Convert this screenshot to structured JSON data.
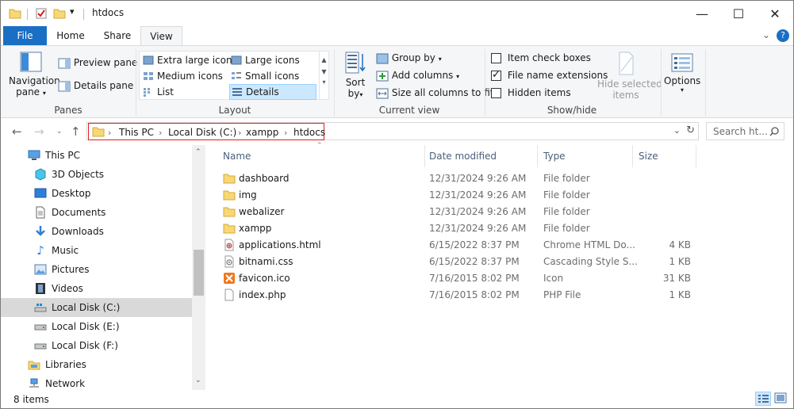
{
  "window": {
    "title": "htdocs",
    "controls": {
      "minimize": "—",
      "maximize": "☐",
      "close": "✕"
    }
  },
  "quick_access": {
    "icons": [
      "folder-icon",
      "properties-check-icon",
      "new-folder-icon",
      "customize-dropdown-icon"
    ],
    "dropdown": "▾"
  },
  "ribbon_tabs": {
    "file": "File",
    "home": "Home",
    "share": "Share",
    "view": "View",
    "expand": "⌄",
    "help": "?"
  },
  "ribbon": {
    "panes": {
      "label": "Panes",
      "navigation_pane": "Navigation",
      "navigation_pane_2": "pane",
      "preview_pane": "Preview pane",
      "details_pane": "Details pane"
    },
    "layout": {
      "label": "Layout",
      "items": {
        "extra_large": "Extra large icons",
        "large": "Large icons",
        "medium": "Medium icons",
        "small": "Small icons",
        "list": "List",
        "details": "Details"
      },
      "selected": "Details"
    },
    "current_view": {
      "label": "Current view",
      "sort_by": "Sort",
      "sort_by_2": "by",
      "group_by": "Group by",
      "add_columns": "Add columns",
      "size_all": "Size all columns to fit"
    },
    "show_hide": {
      "label": "Show/hide",
      "item_check_boxes": {
        "label": "Item check boxes",
        "checked": false
      },
      "file_name_extensions": {
        "label": "File name extensions",
        "checked": true
      },
      "hidden_items": {
        "label": "Hidden items",
        "checked": false
      },
      "hide_selected": "Hide selected",
      "hide_selected_2": "items"
    },
    "options": {
      "label": "Options"
    }
  },
  "address": {
    "crumbs": [
      "This PC",
      "Local Disk (C:)",
      "xampp",
      "htdocs"
    ],
    "search_placeholder": "Search ht..."
  },
  "nav_pane": {
    "items": [
      {
        "label": "This PC",
        "icon": "computer-icon",
        "selected": false
      },
      {
        "label": "3D Objects",
        "icon": "3d-objects-icon",
        "selected": false
      },
      {
        "label": "Desktop",
        "icon": "desktop-icon",
        "selected": false
      },
      {
        "label": "Documents",
        "icon": "documents-icon",
        "selected": false
      },
      {
        "label": "Downloads",
        "icon": "downloads-icon",
        "selected": false
      },
      {
        "label": "Music",
        "icon": "music-icon",
        "selected": false
      },
      {
        "label": "Pictures",
        "icon": "pictures-icon",
        "selected": false
      },
      {
        "label": "Videos",
        "icon": "videos-icon",
        "selected": false
      },
      {
        "label": "Local Disk (C:)",
        "icon": "drive-icon",
        "selected": true
      },
      {
        "label": "Local Disk (E:)",
        "icon": "drive-icon",
        "selected": false
      },
      {
        "label": "Local Disk (F:)",
        "icon": "drive-icon",
        "selected": false
      },
      {
        "label": "Libraries",
        "icon": "libraries-icon",
        "selected": false
      },
      {
        "label": "Network",
        "icon": "network-icon",
        "selected": false
      }
    ]
  },
  "file_list": {
    "columns": {
      "name": "Name",
      "date": "Date modified",
      "type": "Type",
      "size": "Size"
    },
    "rows": [
      {
        "name": "dashboard",
        "date": "12/31/2024 9:26 AM",
        "type": "File folder",
        "size": "",
        "icon": "folder-icon"
      },
      {
        "name": "img",
        "date": "12/31/2024 9:26 AM",
        "type": "File folder",
        "size": "",
        "icon": "folder-icon"
      },
      {
        "name": "webalizer",
        "date": "12/31/2024 9:26 AM",
        "type": "File folder",
        "size": "",
        "icon": "folder-icon"
      },
      {
        "name": "xampp",
        "date": "12/31/2024 9:26 AM",
        "type": "File folder",
        "size": "",
        "icon": "folder-icon"
      },
      {
        "name": "applications.html",
        "date": "6/15/2022 8:37 PM",
        "type": "Chrome HTML Do...",
        "size": "4 KB",
        "icon": "chrome-html-icon"
      },
      {
        "name": "bitnami.css",
        "date": "6/15/2022 8:37 PM",
        "type": "Cascading Style S...",
        "size": "1 KB",
        "icon": "css-file-icon"
      },
      {
        "name": "favicon.ico",
        "date": "7/16/2015 8:02 PM",
        "type": "Icon",
        "size": "31 KB",
        "icon": "xampp-icon"
      },
      {
        "name": "index.php",
        "date": "7/16/2015 8:02 PM",
        "type": "PHP File",
        "size": "1 KB",
        "icon": "php-file-icon"
      }
    ]
  },
  "status_bar": {
    "item_count": "8 items"
  },
  "colors": {
    "accent": "#1a6fc4",
    "selection": "#cce8ff",
    "highlight_border": "#e02020",
    "folder": "#f8d775"
  }
}
